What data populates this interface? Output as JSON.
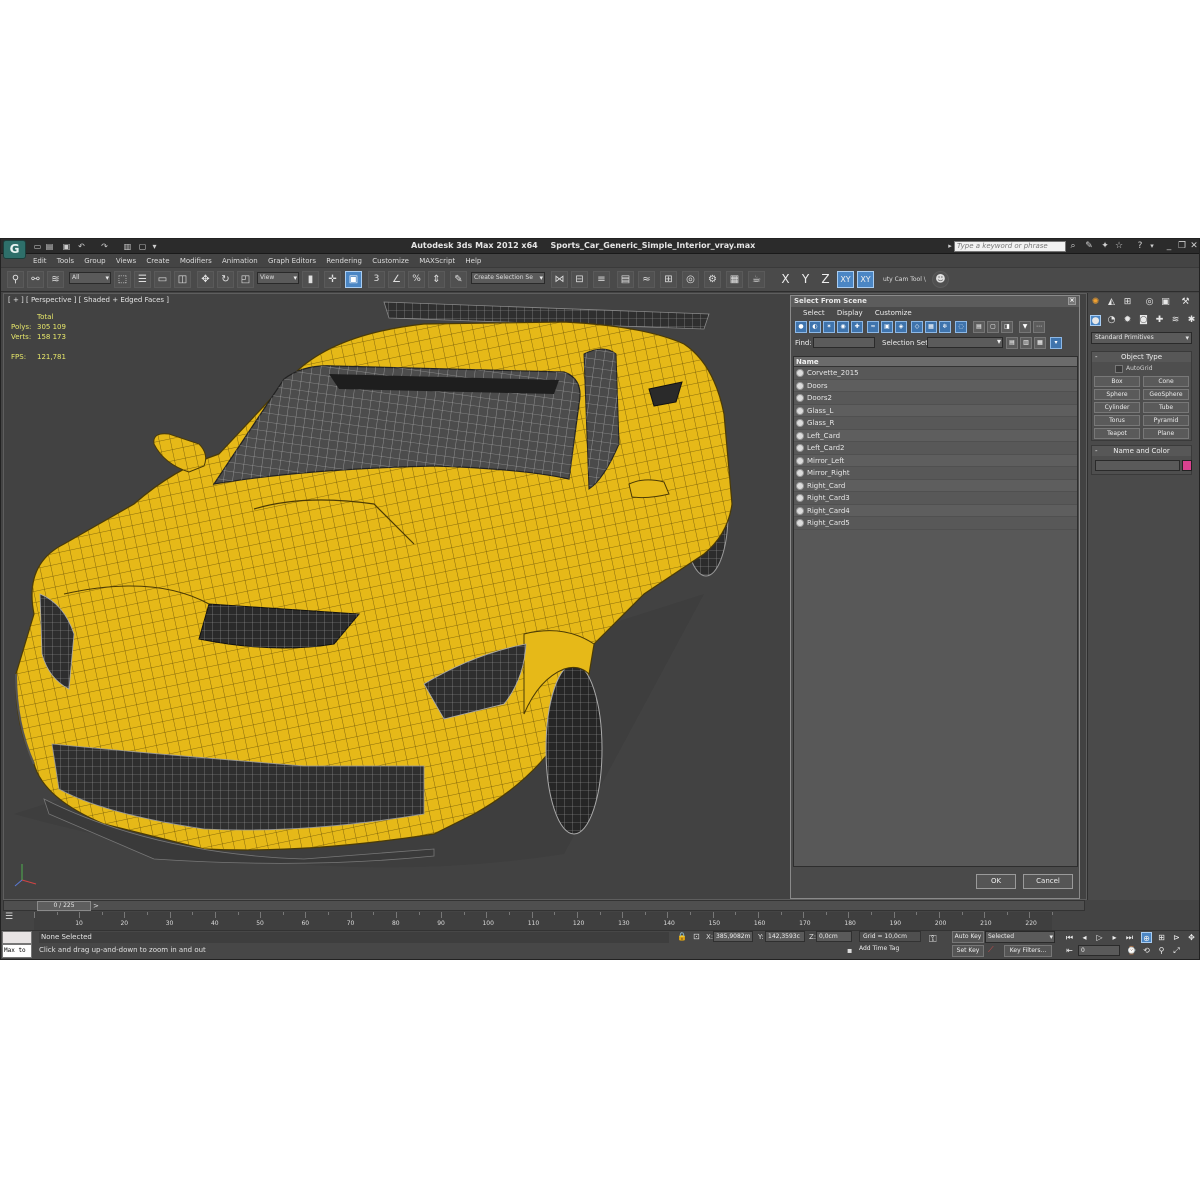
{
  "window": {
    "app_logo": "G",
    "title_app": "Autodesk 3ds Max  2012 x64",
    "title_file": "Sports_Car_Generic_Simple_Interior_vray.max",
    "search_placeholder": "Type a keyword or phrase"
  },
  "menu": [
    "Edit",
    "Tools",
    "Group",
    "Views",
    "Create",
    "Modifiers",
    "Animation",
    "Graph Editors",
    "Rendering",
    "Customize",
    "MAXScript",
    "Help"
  ],
  "toolbar": {
    "filter_value": "All",
    "ref_coord": "View",
    "selection_set": "Create Selection Se",
    "axis_x": "X",
    "axis_y": "Y",
    "axis_z": "Z",
    "axis_xy": "XY",
    "axis_xy2": "XY",
    "cam_tool": "uty Cam Tool \\",
    "snap_3": "3",
    "snap_pct": "%",
    "accent_color": "#4b86c4"
  },
  "viewport": {
    "label": "[ + ] [ Perspective ] [ Shaded + Edged Faces ]",
    "stats_header": "Total",
    "polys_label": "Polys:",
    "polys_value": "305 109",
    "verts_label": "Verts:",
    "verts_value": "158 173",
    "fps_label": "FPS:",
    "fps_value": "121,781",
    "car_color": "#e6b918"
  },
  "dialog": {
    "title": "Select From Scene",
    "menu": [
      "Select",
      "Display",
      "Customize"
    ],
    "find_label": "Find:",
    "selection_set_label": "Selection Set:",
    "column_name": "Name",
    "items": [
      "Corvette_2015",
      "Doors",
      "Doors2",
      "Glass_L",
      "Glass_R",
      "Left_Card",
      "Left_Card2",
      "Mirror_Left",
      "Mirror_Right",
      "Right_Card",
      "Right_Card3",
      "Right_Card4",
      "Right_Card5"
    ],
    "ok": "OK",
    "cancel": "Cancel"
  },
  "command_panel": {
    "dropdown": "Standard Primitives",
    "object_type_title": "Object Type",
    "autogrid_label": "AutoGrid",
    "primitives": [
      "Box",
      "Cone",
      "Sphere",
      "GeoSphere",
      "Cylinder",
      "Tube",
      "Torus",
      "Pyramid",
      "Teapot",
      "Plane"
    ],
    "name_color_title": "Name and Color",
    "swatch_color": "#d8418f"
  },
  "timeline": {
    "slider_label": "0 / 225",
    "next": ">",
    "ticks": [
      "10",
      "20",
      "30",
      "40",
      "50",
      "60",
      "70",
      "80",
      "90",
      "100",
      "110",
      "120",
      "130",
      "140",
      "150",
      "160",
      "170",
      "180",
      "190",
      "200",
      "210",
      "220"
    ]
  },
  "status": {
    "maxscript_label": "Max to",
    "selection": "None Selected",
    "prompt": "Click and drag up-and-down to zoom in and out",
    "x_label": "X:",
    "x_value": "385,9082m",
    "y_label": "Y:",
    "y_value": "142,3593c",
    "z_label": "Z:",
    "z_value": "0,0cm",
    "grid": "Grid = 10,0cm",
    "auto_key": "Auto Key",
    "set_key": "Set Key",
    "selected": "Selected",
    "key_filters": "Key Filters...",
    "add_time_tag": "Add Time Tag",
    "frame": "0"
  }
}
